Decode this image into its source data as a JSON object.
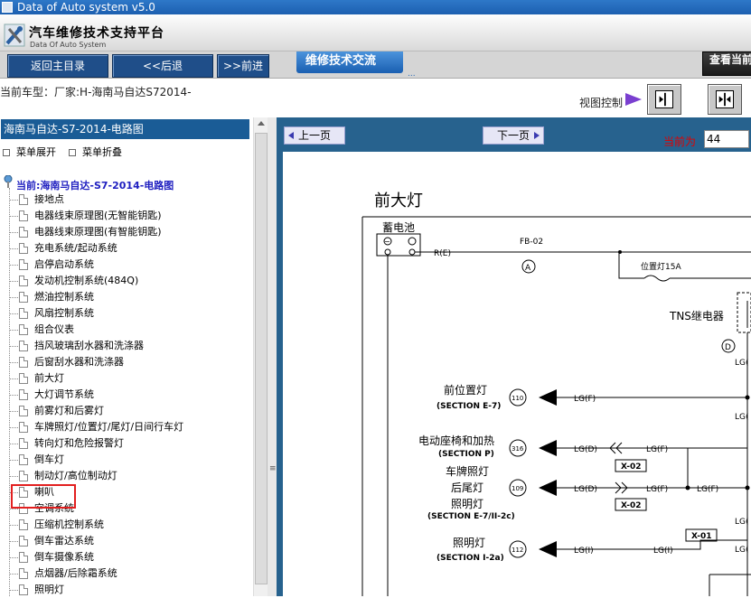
{
  "window": {
    "title": "Data of Auto system v5.0"
  },
  "header": {
    "brand": "汽车维修技术支持平台",
    "brand_sub": "Data Of Auto System"
  },
  "nav": {
    "home": "返回主目录",
    "back": "<<后退",
    "forward": ">>前进",
    "tab": "维修技术交流",
    "tab_more": "...",
    "right_button": "查看当前"
  },
  "carbar": {
    "info": "当前车型：厂家:H-海南马自达S72014-",
    "view_control": "视图控制"
  },
  "left": {
    "title": "海南马自达-S7-2014-电路图",
    "expand": "菜单展开",
    "collapse": "菜单折叠",
    "current": "当前:海南马自达-S7-2014-电路图",
    "items": [
      "接地点",
      "电器线束原理图(无智能钥匙)",
      "电器线束原理图(有智能钥匙)",
      "充电系统/起动系统",
      "启停启动系统",
      "发动机控制系统(484Q)",
      "燃油控制系统",
      "风扇控制系统",
      "组合仪表",
      "挡风玻璃刮水器和洗涤器",
      "后窗刮水器和洗涤器",
      "前大灯",
      "大灯调节系统",
      "前雾灯和后雾灯",
      "车牌照灯/位置灯/尾灯/日间行车灯",
      "转向灯和危险报警灯",
      "倒车灯",
      "制动灯/高位制动灯",
      "喇叭",
      "空调系统",
      "压缩机控制系统",
      "倒车雷达系统",
      "倒车摄像系统",
      "点烟器/后除霜系统",
      "照明灯"
    ],
    "selected_index": 11
  },
  "right": {
    "prev": "上一页",
    "next": "下一页",
    "current_label": "当前为",
    "current_page": "44"
  },
  "diagram": {
    "title": "前大灯",
    "battery": "蓄电池",
    "battery_wire": "R(E)",
    "fuse_block": "FB-02",
    "conn_a": "A",
    "position_fuse": "位置灯15A",
    "relay": "TNS继电器",
    "conn_d": "D",
    "lg_e": "LG(",
    "front_position_lamp": "前位置灯",
    "front_position_section": "(SECTION E-7)",
    "front_position_conn": "110",
    "wire_lgf": "LG(F)",
    "heated_seat": "电动座椅和加热",
    "heated_seat_section": "(SECTION P)",
    "heated_seat_conn": "316",
    "wire_lgd": "LG(D)",
    "conn_x02": "X-02",
    "plate_lamp_1": "车牌照灯",
    "plate_lamp_2": "后尾灯",
    "plate_lamp_3": "照明灯",
    "plate_section": "(SECTION E-7/II-2c)",
    "plate_conn": "109",
    "conn_x02_b": "X-02",
    "illumination": "照明灯",
    "illum_section": "(SECTION I-2a)",
    "illum_conn": "112",
    "wire_lgi": "LG(I)",
    "conn_x01": "X-01",
    "lg_cut_1": "LG(",
    "lg_cut_2": "LG(",
    "lg_cut_3": "LG("
  }
}
